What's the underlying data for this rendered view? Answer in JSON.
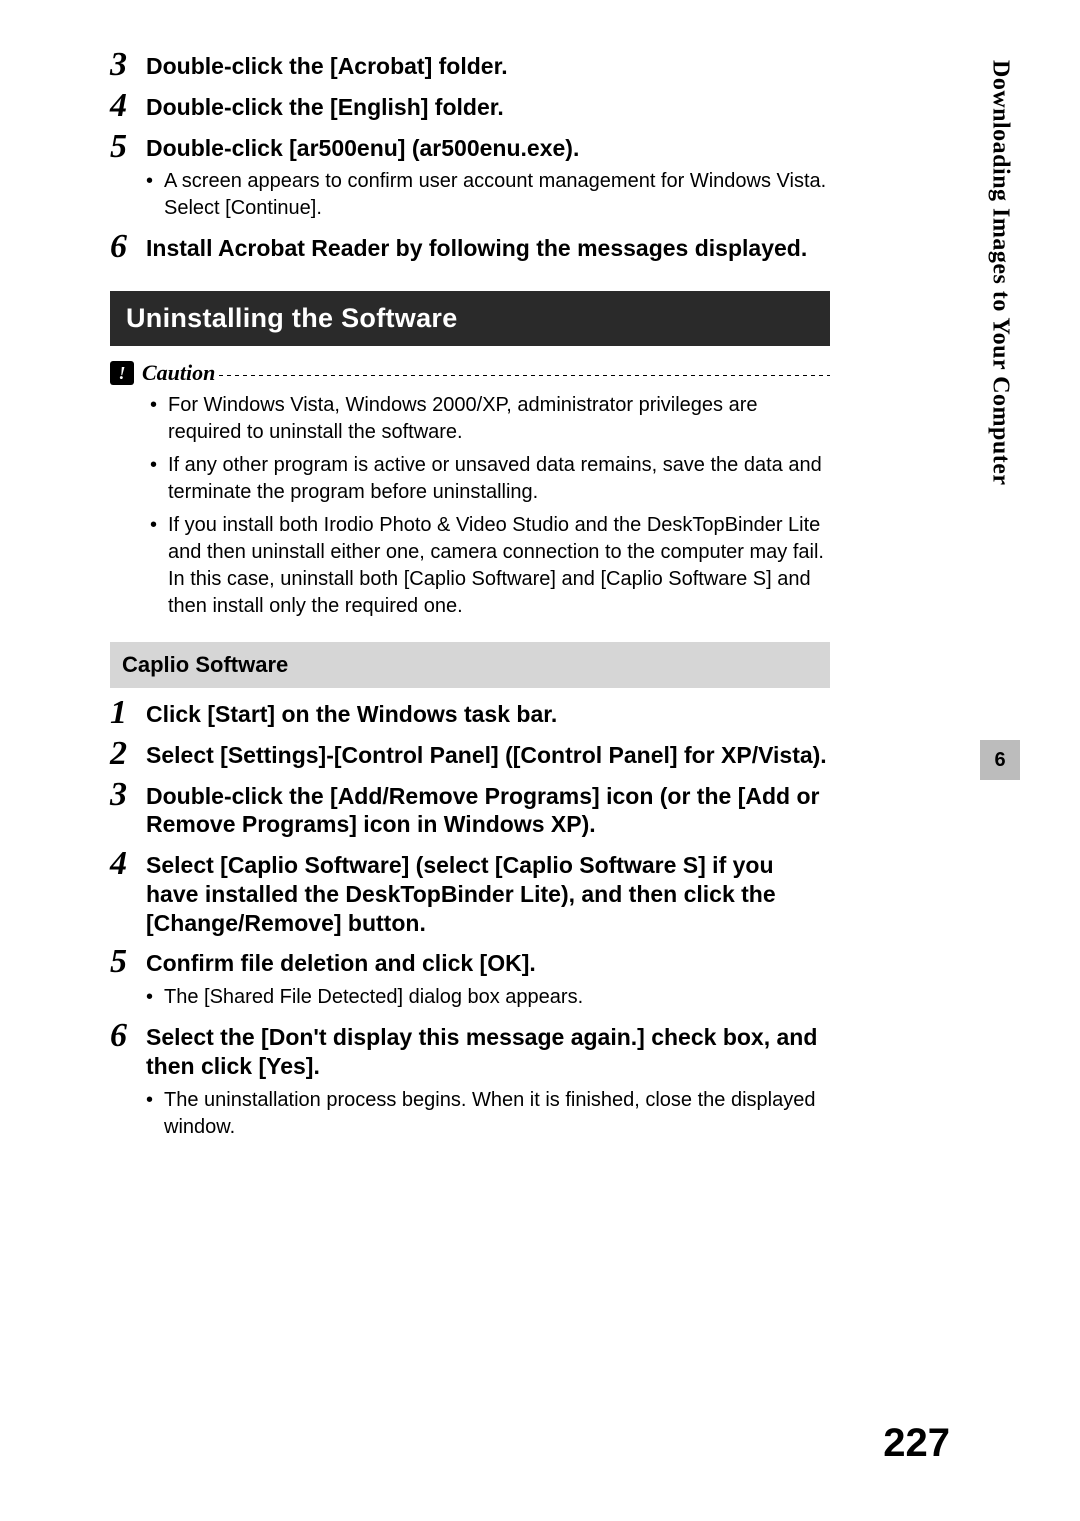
{
  "side": {
    "section_title": "Downloading Images to Your Computer",
    "chapter": "6"
  },
  "page_number": "227",
  "top_steps": [
    {
      "num": "3",
      "title": "Double-click the [Acrobat] folder.",
      "bullets": []
    },
    {
      "num": "4",
      "title": "Double-click the [English] folder.",
      "bullets": []
    },
    {
      "num": "5",
      "title": "Double-click [ar500enu] (ar500enu.exe).",
      "bullets": [
        "A screen appears to confirm user account management for Windows Vista. Select [Continue]."
      ]
    },
    {
      "num": "6",
      "title": "Install Acrobat Reader by following the messages displayed.",
      "bullets": []
    }
  ],
  "section_heading": "Uninstalling the Software",
  "caution": {
    "label": "Caution",
    "items": [
      "For Windows Vista, Windows 2000/XP, administrator privileges are required to uninstall the software.",
      "If any other program is active or unsaved data remains, save the data and terminate the program before uninstalling.",
      "If you install both Irodio Photo & Video Studio and the DeskTopBinder Lite and then uninstall either one, camera connection to the computer may fail. In this case, uninstall both [Caplio Software] and [Caplio Software S] and then install only the required one."
    ]
  },
  "sub_heading": "Caplio Software",
  "uninstall_steps": [
    {
      "num": "1",
      "title": "Click [Start] on the Windows task bar.",
      "bullets": []
    },
    {
      "num": "2",
      "title": "Select [Settings]-[Control Panel] ([Control Panel] for XP/Vista).",
      "bullets": []
    },
    {
      "num": "3",
      "title": "Double-click the [Add/Remove Programs] icon (or the [Add or Remove Programs] icon in Windows XP).",
      "bullets": []
    },
    {
      "num": "4",
      "title": "Select [Caplio Software] (select [Caplio Software S] if you have installed the DeskTopBinder Lite), and then click the [Change/Remove] button.",
      "bullets": []
    },
    {
      "num": "5",
      "title": "Confirm file deletion and click [OK].",
      "bullets": [
        "The [Shared File Detected] dialog box appears."
      ]
    },
    {
      "num": "6",
      "title": "Select the [Don't display this message again.] check box, and then click [Yes].",
      "bullets": [
        "The uninstallation process begins. When it is finished, close the displayed window."
      ]
    }
  ]
}
